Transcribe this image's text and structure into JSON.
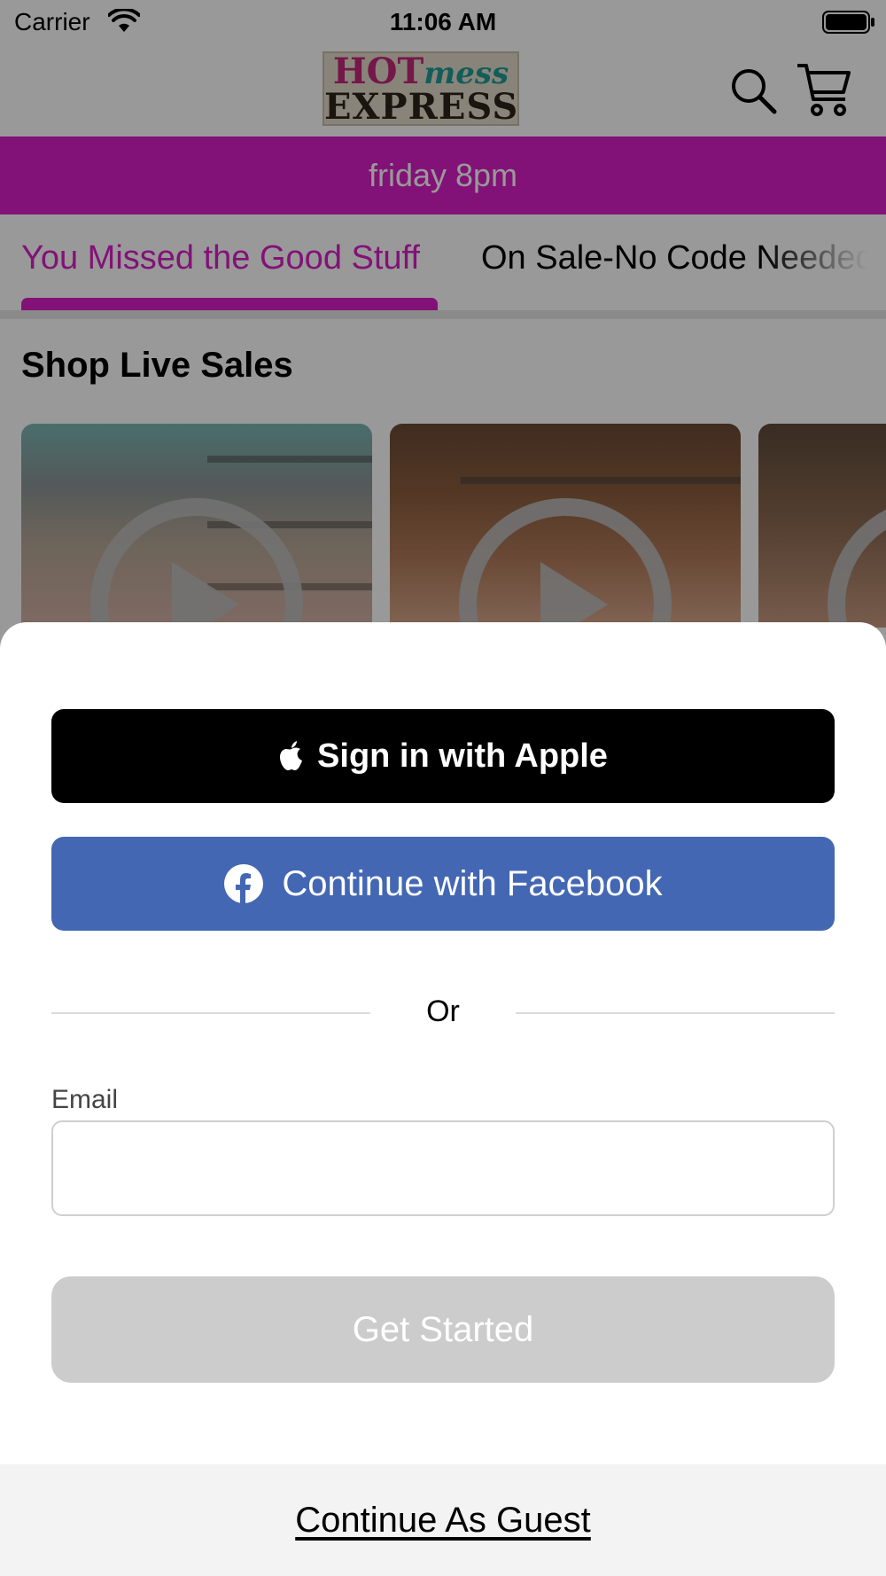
{
  "status_bar": {
    "carrier": "Carrier",
    "time": "11:06 AM"
  },
  "header": {
    "logo": {
      "line1_hot": "HOT",
      "line1_mess": "mess",
      "line2": "EXPRESS"
    },
    "icons": [
      "search-icon",
      "cart-icon"
    ]
  },
  "promo_banner": {
    "text": "friday 8pm",
    "color": "#d91fc7"
  },
  "tabs": [
    {
      "label": "You Missed the Good Stuff",
      "active": true
    },
    {
      "label": "On Sale-No Code Needed",
      "active": false
    }
  ],
  "section": {
    "title": "Shop Live Sales"
  },
  "auth_sheet": {
    "apple_label": "Sign in with Apple",
    "facebook_label": "Continue with Facebook",
    "divider_text": "Or",
    "email_label": "Email",
    "email_value": "",
    "email_placeholder": "",
    "get_started_label": "Get Started",
    "guest_label": "Continue As Guest",
    "colors": {
      "apple": "#000000",
      "facebook": "#4367b3",
      "get_started_disabled": "#cccccc"
    }
  }
}
